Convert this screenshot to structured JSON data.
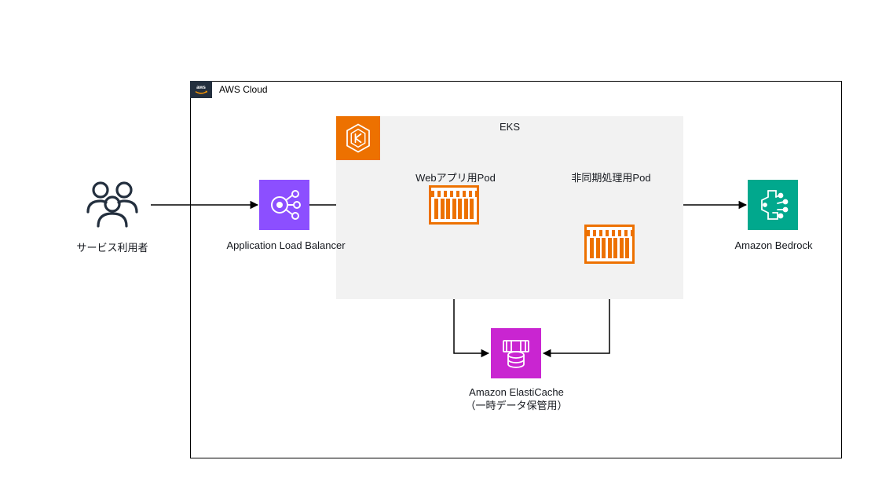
{
  "cloud_label": "AWS Cloud",
  "eks_label": "EKS",
  "users_label": "サービス利用者",
  "alb_label": "Application Load Balancer",
  "web_pod_label": "Webアプリ用Pod",
  "async_pod_label": "非同期処理用Pod",
  "bedrock_label": "Amazon Bedrock",
  "elasticache_label": "Amazon ElastiCache\n（一時データ保管用）",
  "colors": {
    "aws_badge": "#232f3e",
    "eks_orange": "#ed7100",
    "alb_purple": "#8c4fff",
    "bedrock_teal": "#01a88d",
    "elasticache_magenta": "#c925d1",
    "eks_bg": "#f2f2f2"
  },
  "connections": [
    [
      "users",
      "alb"
    ],
    [
      "alb",
      "web_pod"
    ],
    [
      "web_pod",
      "async_pod"
    ],
    [
      "async_pod",
      "bedrock"
    ],
    [
      "web_pod",
      "elasticache"
    ],
    [
      "async_pod",
      "elasticache"
    ]
  ]
}
